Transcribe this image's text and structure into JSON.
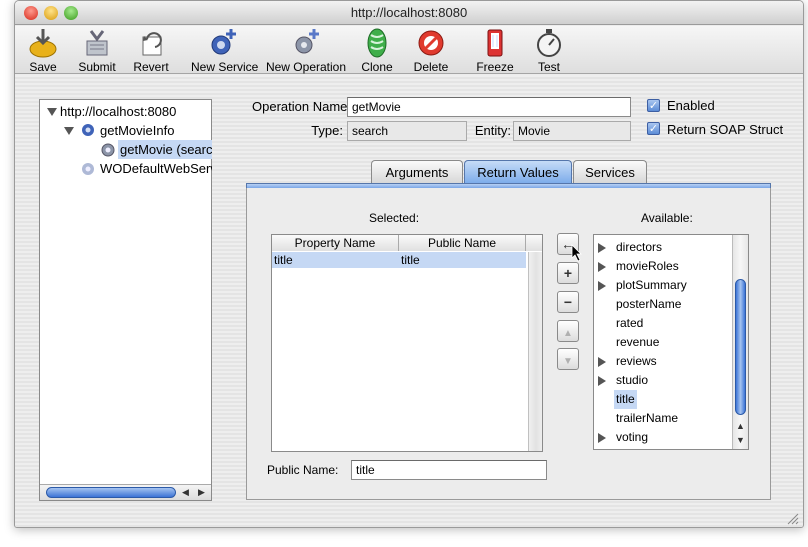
{
  "window": {
    "title": "http://localhost:8080"
  },
  "toolbar": {
    "buttons": [
      {
        "label": "Save",
        "icon": "save-icon"
      },
      {
        "label": "Submit",
        "icon": "submit-icon"
      },
      {
        "label": "Revert",
        "icon": "revert-icon"
      },
      {
        "label": "New Service",
        "icon": "new-service-icon"
      },
      {
        "label": "New Operation",
        "icon": "new-operation-icon"
      },
      {
        "label": "Clone",
        "icon": "clone-icon"
      },
      {
        "label": "Delete",
        "icon": "delete-icon"
      },
      {
        "label": "Freeze",
        "icon": "freeze-icon"
      },
      {
        "label": "Test",
        "icon": "test-icon"
      }
    ]
  },
  "tree": {
    "root": "http://localhost:8080",
    "service": "getMovieInfo",
    "operation": "getMovie (searc",
    "other": "WODefaultWebServ"
  },
  "operation": {
    "name_label": "Operation Name:",
    "name_value": "getMovie",
    "type_label": "Type:",
    "type_value": "search",
    "entity_label": "Entity:",
    "entity_value": "Movie",
    "enabled_label": "Enabled",
    "soap_label": "Return SOAP Struct"
  },
  "tabs": [
    "Arguments",
    "Return Values",
    "Services"
  ],
  "selected": {
    "label": "Selected:",
    "columns": [
      "Property Name",
      "Public Name"
    ],
    "rows": [
      {
        "property": "title",
        "public": "title"
      }
    ]
  },
  "available": {
    "label": "Available:",
    "items": [
      "directors",
      "movieRoles",
      "plotSummary",
      "posterName",
      "rated",
      "revenue",
      "reviews",
      "studio",
      "title",
      "trailerName",
      "voting"
    ]
  },
  "public_name": {
    "label": "Public Name:",
    "value": "title"
  },
  "colors": {
    "accent": "#5b8cd6",
    "selection": "#c5d8f4"
  }
}
